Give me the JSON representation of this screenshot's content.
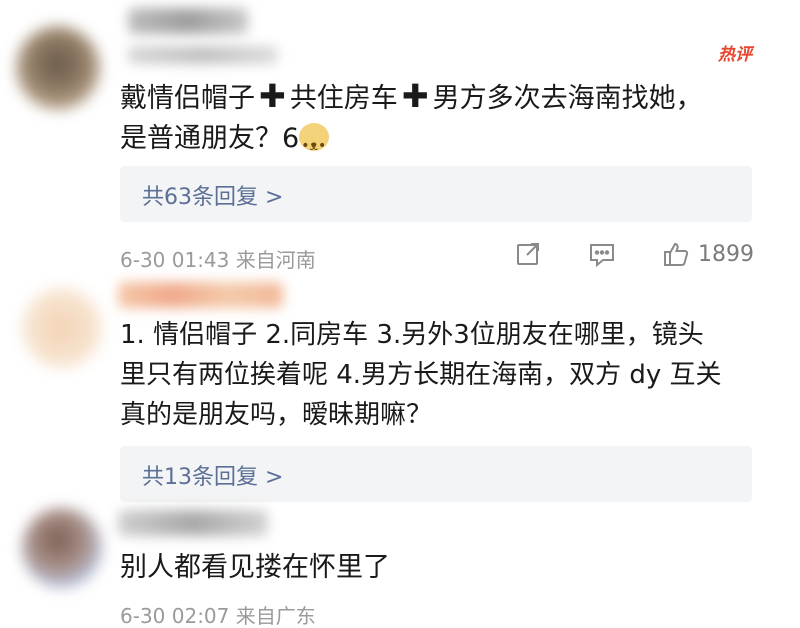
{
  "comments": [
    {
      "hot_label": "热评",
      "text_parts": [
        "戴情侣帽子",
        "共住房车",
        "男方多次去海南找她，",
        "是普通朋友？6"
      ],
      "plus_symbol": "✚",
      "emoji": "dog-face-emoji",
      "replies_label": "共63条回复 >",
      "time": "6-30 01:43",
      "location": "来自河南",
      "likes": "1899"
    },
    {
      "lines": [
        "1. 情侣帽子  2.同房车  3.另外3位朋友在哪里，镜头",
        "里只有两位挨着呢  4.男方长期在海南，双方 dy 互关",
        "真的是朋友吗，暧昧期嘛？"
      ],
      "replies_label": "共13条回复 >"
    },
    {
      "text": "别人都看见搂在怀里了",
      "time": "6-30 02:07",
      "location": "来自广东"
    }
  ],
  "icons": {
    "share": "share-icon",
    "comment": "comment-icon",
    "like": "thumbs-up-icon"
  },
  "colors": {
    "hot": "#e8452e",
    "link": "#5c6f96",
    "meta": "#9a9a9a",
    "reply_bg": "#f3f4f5"
  }
}
